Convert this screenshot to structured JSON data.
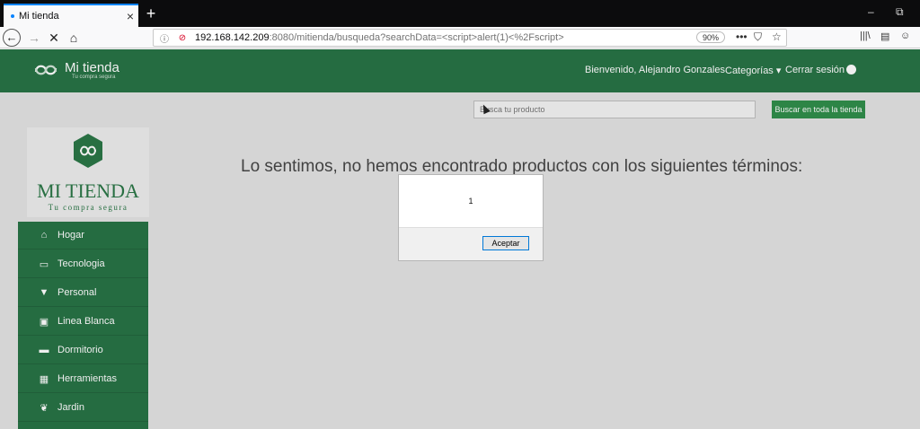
{
  "browser": {
    "tab_title": "Mi tienda",
    "tab_close": "×",
    "new_tab": "+",
    "url_host": "192.168.142.209",
    "url_path": ":8080/mitienda/busqueda?searchData=<script>alert(1)<%2Fscript>",
    "zoom": "90%",
    "more_actions": "•••",
    "win_minimize": "–",
    "win_restore": "⧉"
  },
  "header": {
    "brand": "Mi tienda",
    "brand_tagline": "Tu compra segura",
    "welcome": "Bienvenido, Alejandro Gonzales",
    "categories": "Categorías ▾",
    "logout": "Cerrar sesión"
  },
  "search": {
    "placeholder": "Busca tu producto",
    "button": "Buscar en toda la tienda"
  },
  "side_logo": {
    "title": "MI TIENDA",
    "subtitle": "Tu compra segura"
  },
  "menu": {
    "items": [
      {
        "label": "Hogar",
        "icon": "home-icon"
      },
      {
        "label": "Tecnologia",
        "icon": "laptop-icon"
      },
      {
        "label": "Personal",
        "icon": "shirt-icon"
      },
      {
        "label": "Linea Blanca",
        "icon": "gift-icon"
      },
      {
        "label": "Dormitorio",
        "icon": "bed-icon"
      },
      {
        "label": "Herramientas",
        "icon": "calendar-icon"
      },
      {
        "label": "Jardin",
        "icon": "leaf-icon"
      }
    ]
  },
  "main": {
    "message": "Lo sentimos, no hemos encontrado productos con los siguientes términos:"
  },
  "alert": {
    "message": "1",
    "ok_button": "Aceptar"
  },
  "colors": {
    "brand_green": "#1a6a3a",
    "button_green": "#23873f",
    "accent_blue": "#0a84ff"
  }
}
